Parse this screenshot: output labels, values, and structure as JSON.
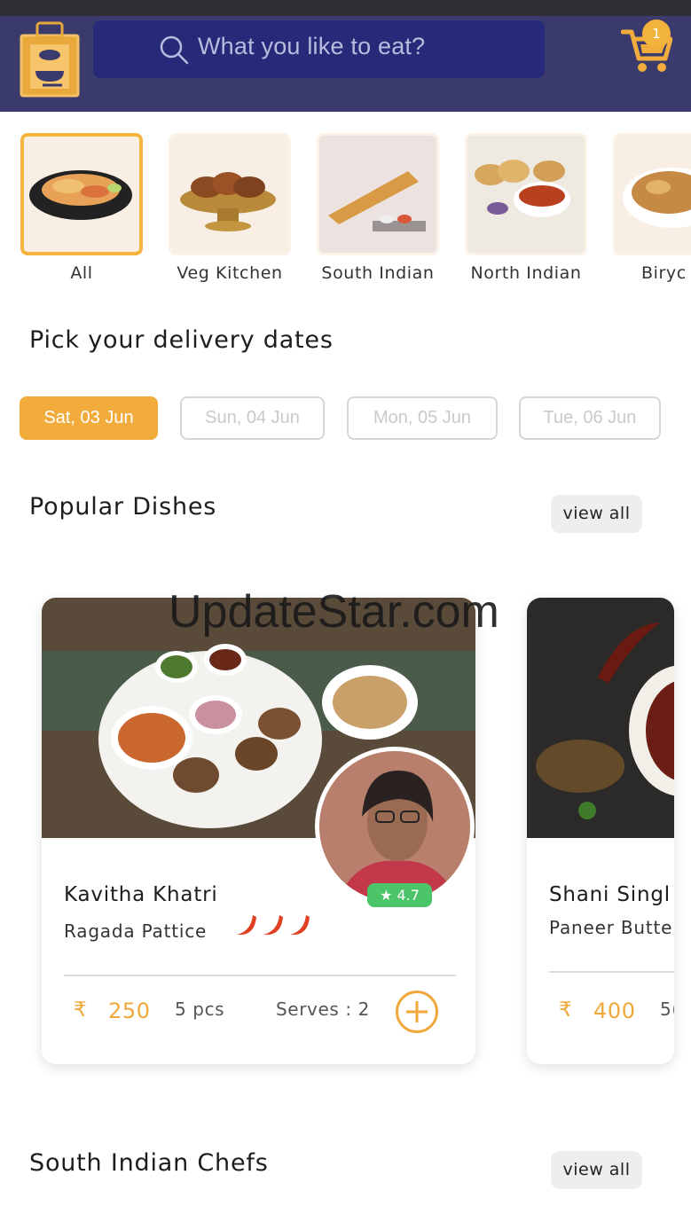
{
  "header": {
    "search_placeholder": "What you like to eat?",
    "cart_count": "1",
    "icons": [
      "app-logo-icon",
      "search-icon",
      "cart-icon"
    ],
    "colors": {
      "header_bg": "#3a3a6c",
      "search_bg": "#272a78",
      "accent": "#f1ac3c"
    }
  },
  "categories": [
    {
      "label": "All",
      "active": true
    },
    {
      "label": "Veg Kitchen",
      "active": false
    },
    {
      "label": "South Indian",
      "active": false
    },
    {
      "label": "North Indian",
      "active": false
    },
    {
      "label": "Biryc",
      "active": false
    }
  ],
  "delivery": {
    "title": "Pick your delivery dates",
    "dates": [
      {
        "label": "Sat, 03 Jun",
        "selected": true
      },
      {
        "label": "Sun, 04 Jun",
        "selected": false
      },
      {
        "label": "Mon, 05 Jun",
        "selected": false
      },
      {
        "label": "Tue, 06 Jun",
        "selected": false
      }
    ]
  },
  "popular": {
    "title": "Popular Dishes",
    "view_all": "view all",
    "watermark": "UpdateStar.com",
    "cards": [
      {
        "chef": "Kavitha Khatri",
        "dish": "Ragada Pattice",
        "rating": "★ 4.7",
        "currency": "₹",
        "price": "250",
        "quantity": "5 pcs",
        "serves": "Serves : 2",
        "spice_level": 3
      },
      {
        "chef": "Shani Singl",
        "dish": "Paneer Butte",
        "currency": "₹",
        "price": "400",
        "quantity": "5("
      }
    ]
  },
  "south_indian": {
    "title": "South Indian Chefs",
    "view_all": "view all"
  }
}
